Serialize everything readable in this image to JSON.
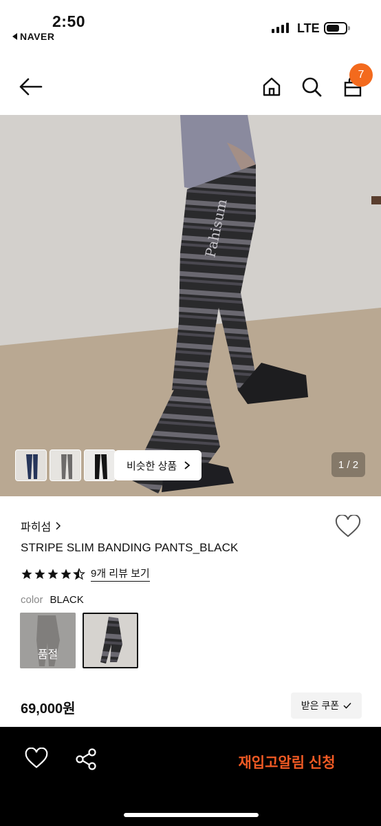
{
  "status_bar": {
    "time": "2:50",
    "back_app": "NAVER",
    "carrier": "LTE"
  },
  "header": {
    "cart_count": "7",
    "accent_color": "#f36a1d"
  },
  "gallery": {
    "similar_label": "비슷한 상품",
    "pager": "1 / 2"
  },
  "product": {
    "brand": "파히섬",
    "title": "STRIPE SLIM BANDING PANTS_BLACK",
    "rating_stars": 4.5,
    "review_link": "9개 리뷰 보기",
    "color_label": "color",
    "color_value": "BLACK",
    "soldout_label": "품절",
    "price": "69,000원",
    "coupon_label": "받은 쿠폰"
  },
  "bottom_bar": {
    "restock_label": "재입고알림 신청",
    "restock_color": "#f15a24"
  },
  "icons": [
    "back-arrow-icon",
    "home-icon",
    "search-icon",
    "cart-icon",
    "heart-icon",
    "share-icon",
    "chevron-right-icon",
    "star-icon",
    "check-icon"
  ]
}
